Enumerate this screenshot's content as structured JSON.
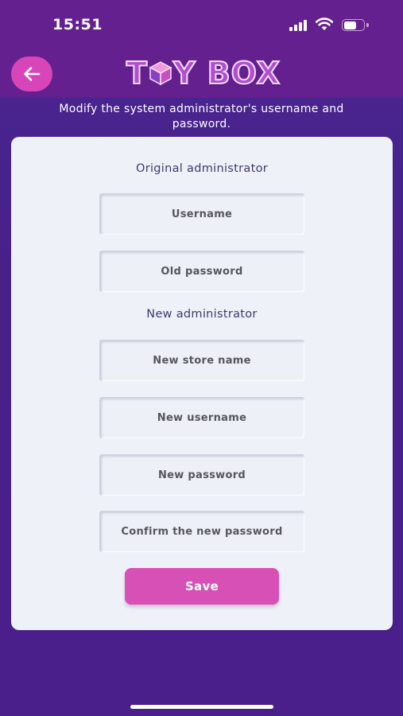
{
  "status_bar": {
    "time": "15:51"
  },
  "header": {
    "logo_text_left": "T",
    "logo_text_right": "Y BOX",
    "back_icon": "arrow-left-icon"
  },
  "subtitle": "Modify the system administrator's username and password.",
  "form": {
    "original_section_title": "Original administrator",
    "username_placeholder": "Username",
    "old_password_placeholder": "Old password",
    "new_section_title": "New administrator",
    "new_store_name_placeholder": "New store name",
    "new_username_placeholder": "New username",
    "new_password_placeholder": "New password",
    "confirm_password_placeholder": "Confirm the new password",
    "save_label": "Save"
  },
  "colors": {
    "header_bg": "#65208f",
    "page_bg": "#47208a",
    "accent": "#d750b5",
    "card_bg": "#eef1f8"
  }
}
